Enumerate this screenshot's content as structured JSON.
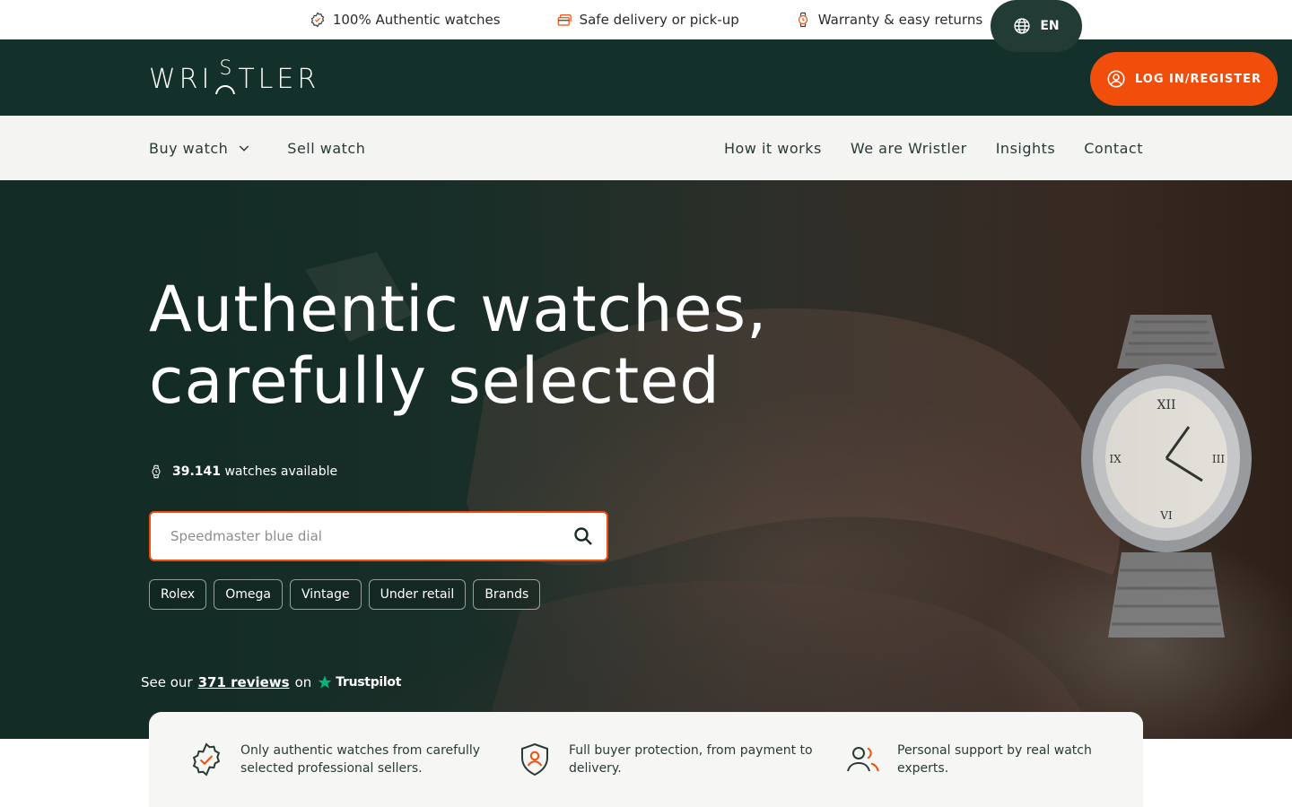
{
  "usp_bar": {
    "items": [
      {
        "icon": "badge-check-icon",
        "label": "100% Authentic watches"
      },
      {
        "icon": "delivery-box-icon",
        "label": "Safe delivery or pick-up"
      },
      {
        "icon": "watch-icon",
        "label": "Warranty & easy returns"
      }
    ]
  },
  "header": {
    "logo_text_left": "WRI",
    "logo_s": "S",
    "logo_text_right": "TLER",
    "language_label": "EN",
    "login_label": "LOG IN/REGISTER"
  },
  "nav": {
    "left": [
      {
        "label": "Buy watch",
        "has_dropdown": true
      },
      {
        "label": "Sell watch"
      }
    ],
    "right": [
      {
        "label": "How it works"
      },
      {
        "label": "We are Wristler"
      },
      {
        "label": "Insights"
      },
      {
        "label": "Contact"
      }
    ]
  },
  "hero": {
    "title_line1": "Authentic watches,",
    "title_line2": "carefully selected",
    "available_count": "39.141",
    "available_suffix": "watches available",
    "search_placeholder": "Speedmaster blue dial",
    "chips": [
      "Rolex",
      "Omega",
      "Vintage",
      "Under retail",
      "Brands"
    ],
    "reviews_prefix": "See our",
    "reviews_link": "371 reviews",
    "reviews_on": "on",
    "trustpilot": "Trustpilot"
  },
  "features": [
    {
      "icon": "authentic-badge-icon",
      "text": "Only authentic watches from carefully selected professional sellers."
    },
    {
      "icon": "shield-user-icon",
      "text": "Full buyer protection, from payment to delivery."
    },
    {
      "icon": "people-support-icon",
      "text": "Personal support by real watch experts."
    }
  ],
  "colors": {
    "brand_dark": "#14302a",
    "accent": "#f04e0a",
    "nav_bg": "#f4f4f3"
  }
}
